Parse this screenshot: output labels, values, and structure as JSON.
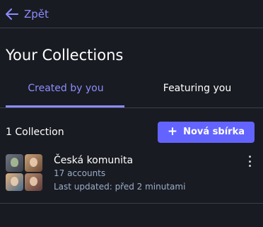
{
  "nav": {
    "back_label": "Zpět"
  },
  "page": {
    "title": "Your Collections"
  },
  "tabs": [
    {
      "label": "Created by you",
      "active": true
    },
    {
      "label": "Featuring you",
      "active": false
    }
  ],
  "list_header": {
    "count_label": "1 Collection",
    "new_button_label": "Nová sbírka"
  },
  "collections": [
    {
      "name": "Česká komunita",
      "accounts": "17 accounts",
      "updated": "Last updated: před 2 minutami"
    }
  ],
  "colors": {
    "accent": "#8c8dff",
    "button": "#6364ff",
    "background": "#191b22",
    "divider": "#393f4f",
    "muted_text": "#9baec8"
  },
  "icons": {
    "back": "arrow-left-icon",
    "add": "plus-icon",
    "menu": "more-vertical-icon"
  }
}
